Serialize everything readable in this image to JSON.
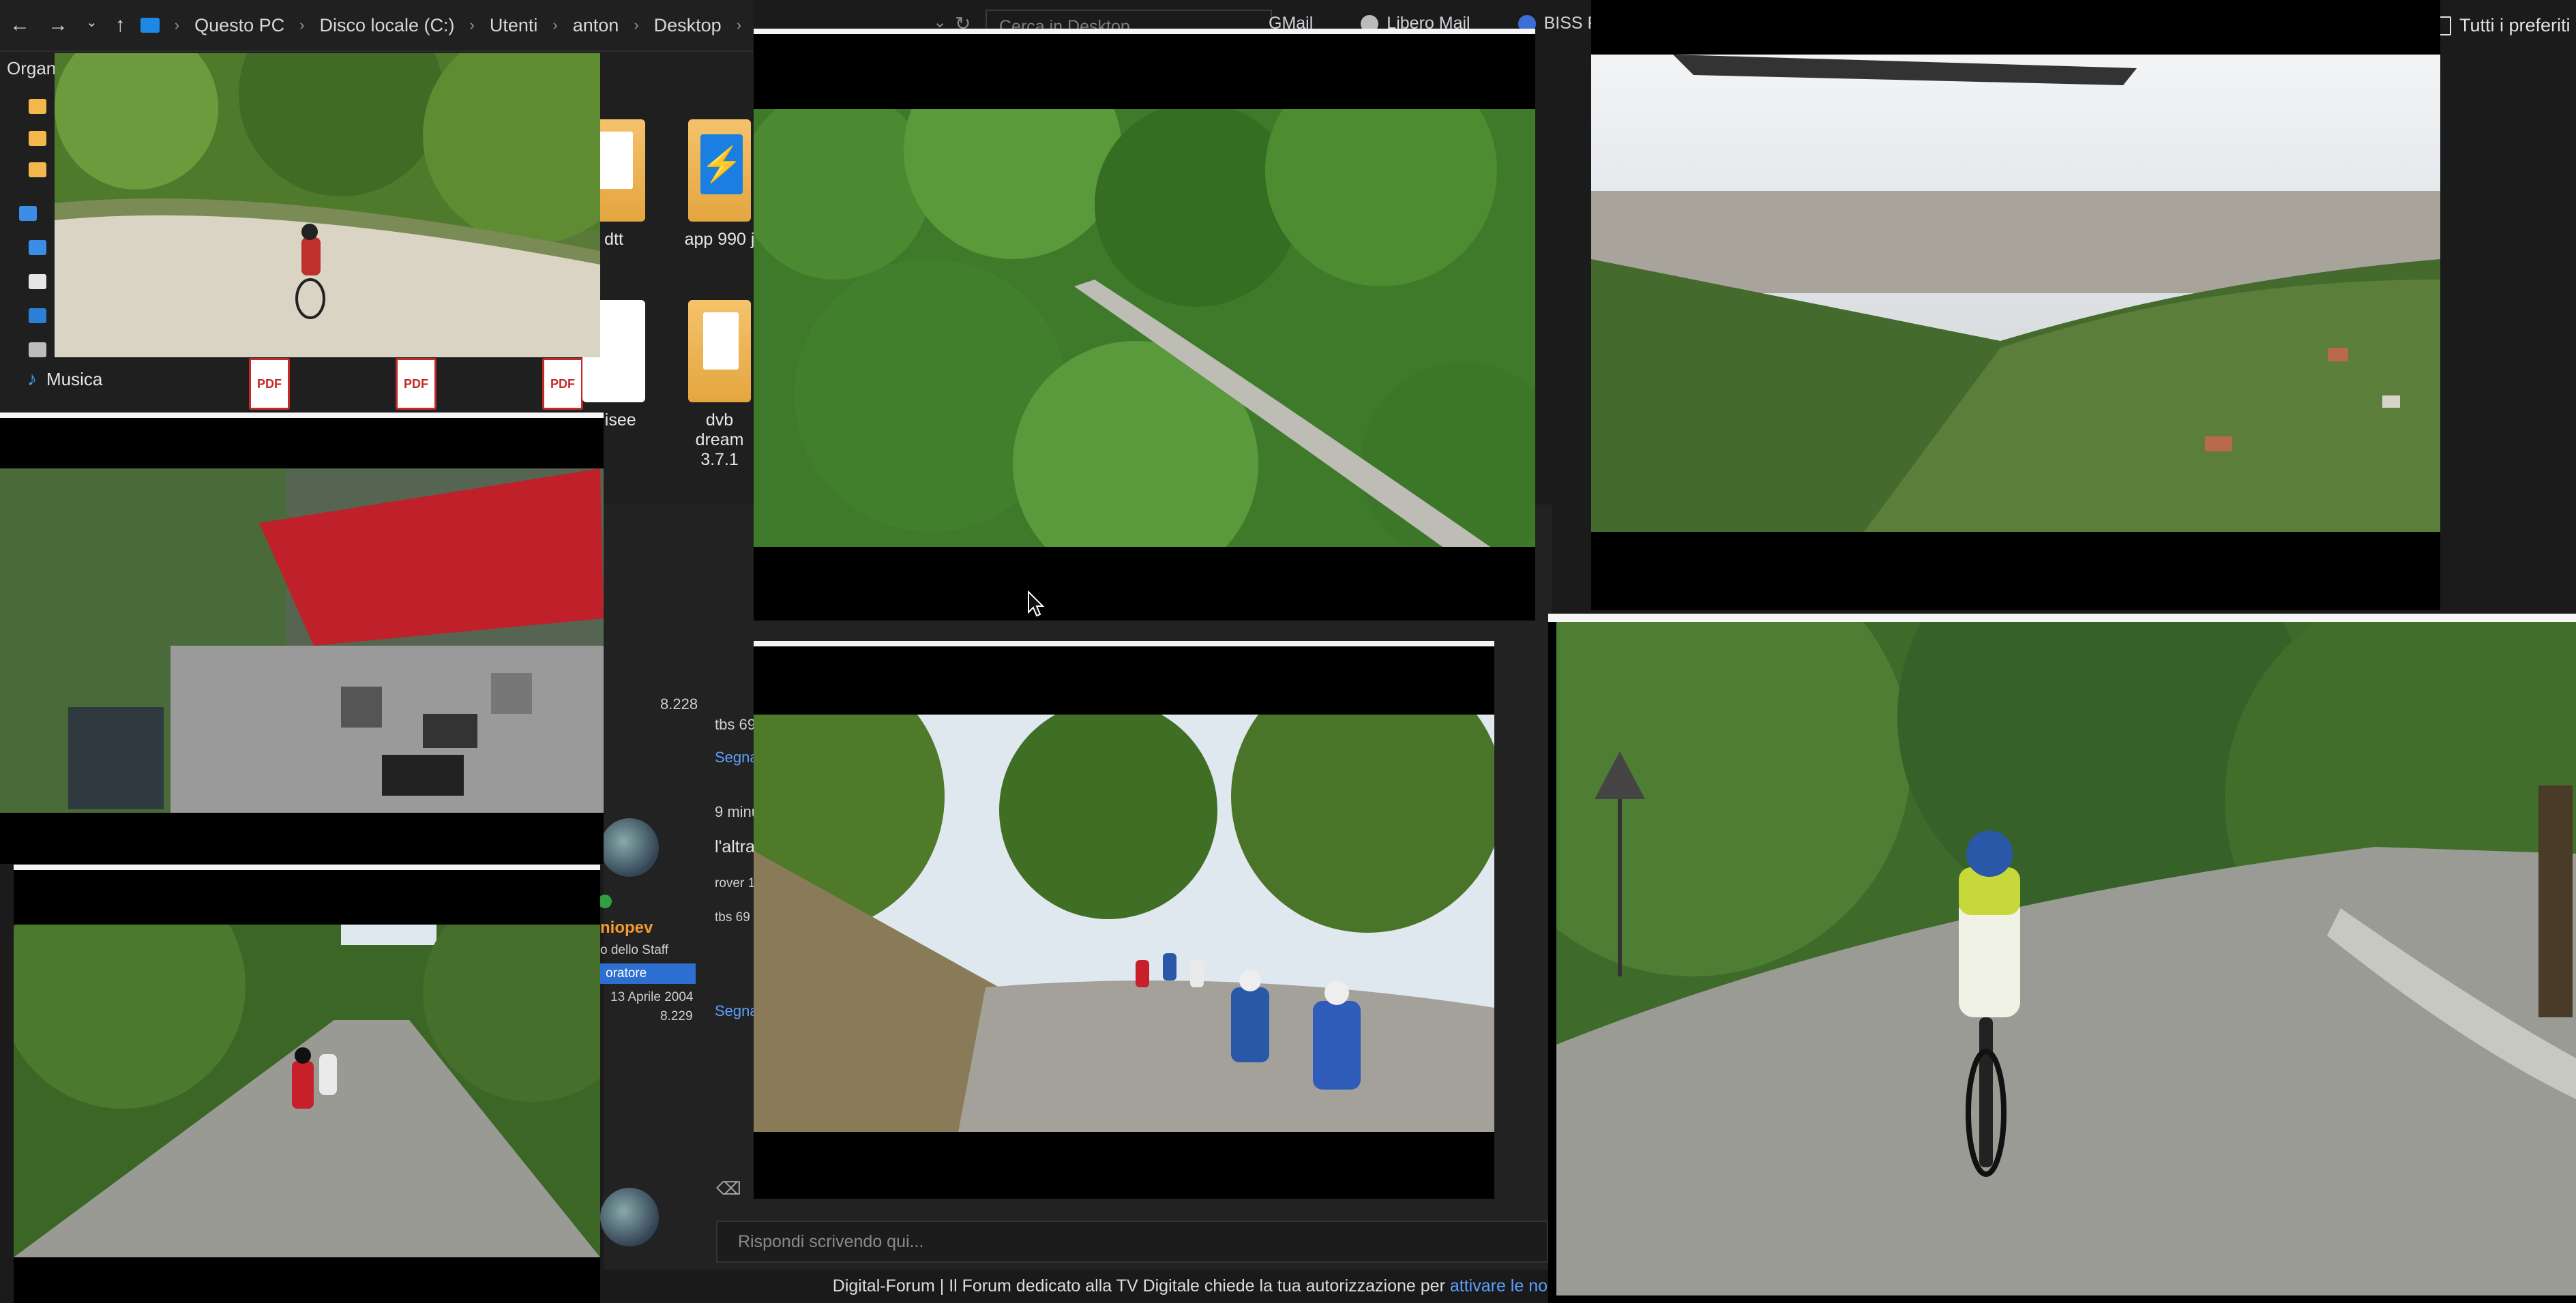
{
  "explorer": {
    "breadcrumb": [
      "Questo PC",
      "Disco locale (C:)",
      "Utenti",
      "anton",
      "Desktop"
    ],
    "search_placeholder": "Cerca in Desktop",
    "organize_label": "Organ",
    "sidebar_music": "Musica",
    "files": [
      {
        "label": "dtt"
      },
      {
        "label": "app 990 j"
      },
      {
        "label": "x isee"
      },
      {
        "label": "dvb dream 3.7.1"
      }
    ]
  },
  "browser": {
    "bookmarks": [
      {
        "label": "GMail",
        "color": "#ea4335"
      },
      {
        "label": "Libero Mail",
        "color": "#bbbbbb"
      },
      {
        "label": "BISS Feeds",
        "color": "#3b6fd6"
      }
    ],
    "favorites_label": "Tutti i preferiti"
  },
  "forum": {
    "post1": {
      "count": "8.228",
      "snippet": "tbs 69",
      "link": "Segna"
    },
    "post2": {
      "time": "9 minu",
      "line1": "l'altra",
      "line2": "rover 1",
      "line3": "tbs 69",
      "username": "niopev",
      "staff": "o dello Staff",
      "role": "oratore",
      "joined": "13 Aprile 2004",
      "count": "8.229",
      "link": "Segna"
    },
    "reply_placeholder": "Rispondi scrivendo qui...",
    "cookie_text": "Digital-Forum | Il Forum dedicato alla TV Digitale chiede la tua autorizzazione per",
    "cookie_link": "attivare le no"
  },
  "colors": {
    "accent_blue": "#2c6fd1",
    "username_orange": "#f29a2e",
    "online_green": "#2ea043"
  }
}
